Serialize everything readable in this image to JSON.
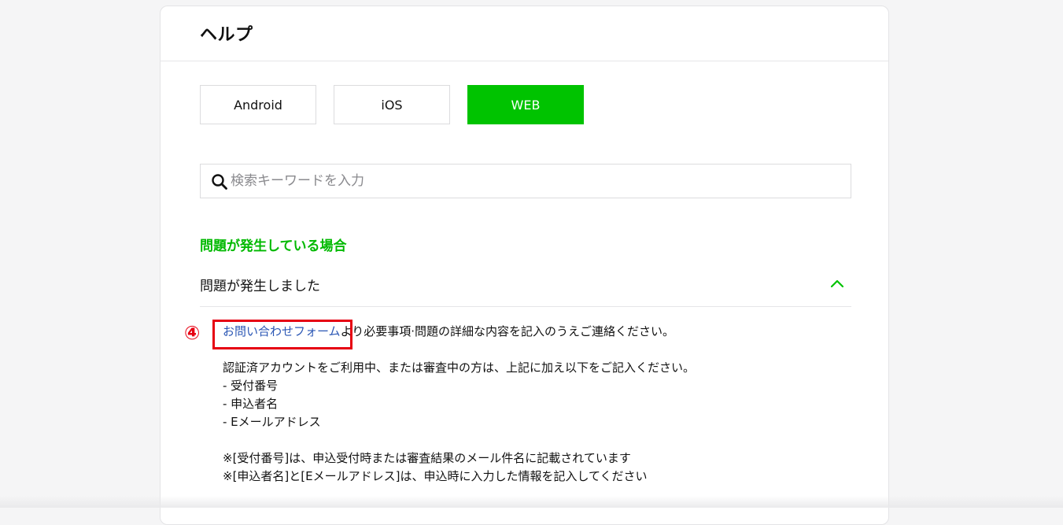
{
  "header": {
    "title": "ヘルプ"
  },
  "os_tabs": [
    {
      "label": "Android",
      "active": false
    },
    {
      "label": "iOS",
      "active": false
    },
    {
      "label": "WEB",
      "active": true
    }
  ],
  "search": {
    "placeholder": "検索キーワードを入力",
    "value": ""
  },
  "section": {
    "title": "問題が発生している場合"
  },
  "faq": {
    "question": "問題が発生しました",
    "expanded": true,
    "answer": {
      "link_text": "お問い合わせフォーム",
      "line1_rest": "より必要事項·問題の詳細な内容を記入のうえご連絡ください。",
      "line2": "認証済アカウントをご利用中、または審査中の方は、上記に加え以下をご記入ください。",
      "list": [
        "- 受付番号",
        "- 申込者名",
        "- Eメールアドレス"
      ],
      "note1": "※[受付番号]は、申込受付時または審査結果のメール件名に記載されています",
      "note2": "※[申込者名]と[Eメールアドレス]は、申込時に入力した情報を記入してください"
    }
  },
  "annotation": {
    "step_label": "④"
  },
  "colors": {
    "accent_green": "#00c300",
    "section_green": "#00b900",
    "link_blue": "#2a56b4",
    "highlight_red": "#e60012"
  },
  "icons": {
    "search": "search-icon",
    "chevron": "chevron-up-icon"
  }
}
